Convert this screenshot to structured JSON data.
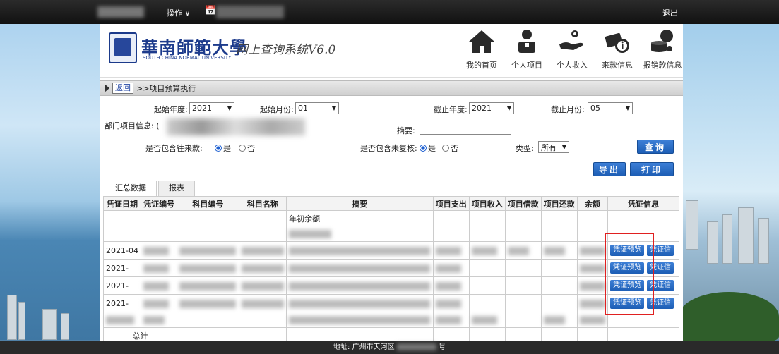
{
  "topbar": {
    "ops_label": "操作 ∨",
    "calendar_glyph": "📅",
    "logout_label": "退出"
  },
  "header": {
    "logo_cn": "華南師範大學",
    "logo_en": "SOUTH CHINA NORMAL UNIVERSITY",
    "system_title": "网上查询系统V6.0",
    "nav": [
      {
        "label": "我的首页",
        "icon": "home-icon"
      },
      {
        "label": "个人项目",
        "icon": "person-icon"
      },
      {
        "label": "个人收入",
        "icon": "hand-coin-icon"
      },
      {
        "label": "来款信息",
        "icon": "money-info-icon"
      },
      {
        "label": "报销款信息",
        "icon": "coins-icon"
      }
    ]
  },
  "breadcrumb": {
    "back_label": "返回",
    "path": ">>项目预算执行"
  },
  "filters": {
    "start_year_label": "起始年度:",
    "start_year_value": "2021",
    "start_month_label": "起始月份:",
    "start_month_value": "01",
    "end_year_label": "截止年度:",
    "end_year_value": "2021",
    "end_month_label": "截止月份:",
    "end_month_value": "05",
    "dept_label": "部门项目信息: (",
    "summary_label": "摘要:",
    "summary_value": "",
    "include_prior_label": "是否包含往来款:",
    "include_unreviewed_label": "是否包含未复核:",
    "yes": "是",
    "no": "否",
    "type_label": "类型:",
    "type_value": "所有",
    "query_btn": "查询",
    "export_btn": "导出",
    "print_btn": "打印"
  },
  "tabs": [
    "汇总数据",
    "报表"
  ],
  "table": {
    "headers": [
      "凭证日期",
      "凭证编号",
      "科目编号",
      "科目名称",
      "摘要",
      "项目支出",
      "项目收入",
      "项目借款",
      "项目还款",
      "余额",
      "凭证信息"
    ],
    "opening_balance": "年初余额",
    "row_dates": [
      "2021-04",
      "2021-",
      "2021-",
      "2021-"
    ],
    "preview_btn": "凭证预览",
    "info_btn": "凭证信",
    "total_label": "总计"
  },
  "footer": {
    "address_prefix": "地址: 广州市天河区",
    "address_suffix": "号"
  }
}
